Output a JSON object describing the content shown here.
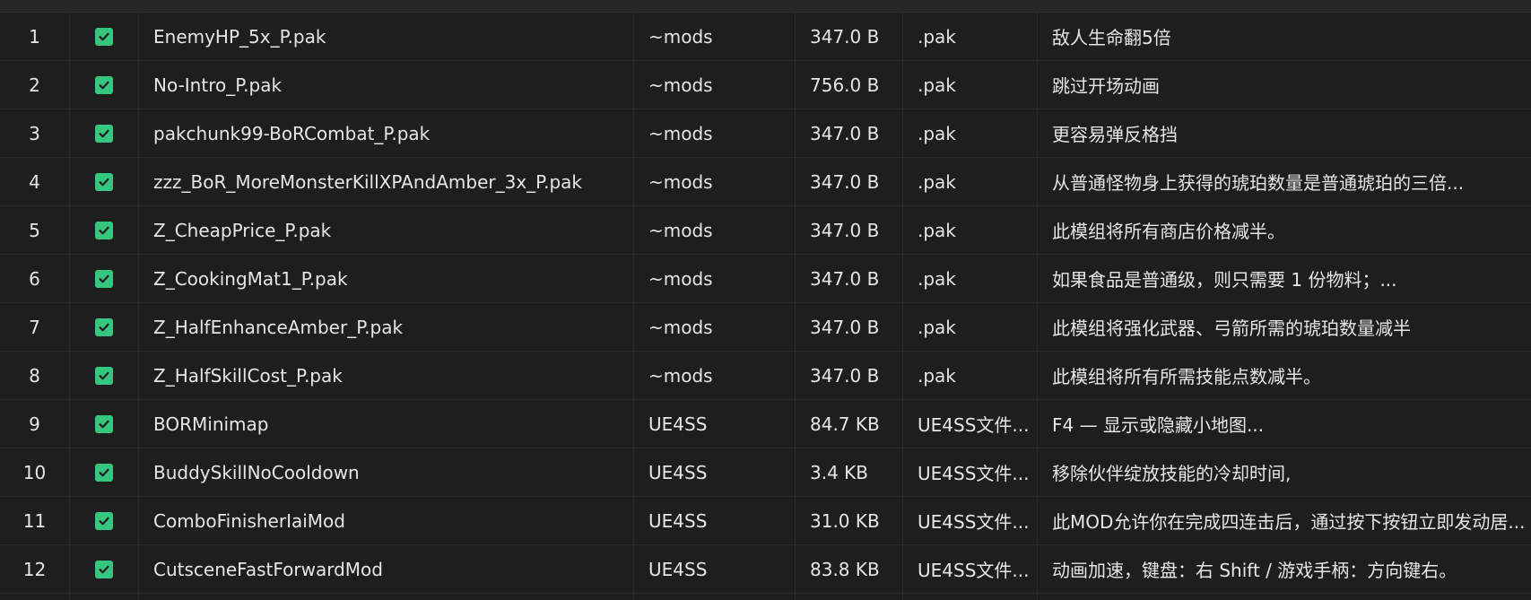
{
  "colors": {
    "background": "#1e1e1e",
    "row_border": "#2b2b2b",
    "checkbox_green": "#35c77f",
    "text": "#e6e6e6"
  },
  "rows": [
    {
      "index": "1",
      "checked": true,
      "name": "EnemyHP_5x_P.pak",
      "dir": "~mods",
      "size": "347.0 B",
      "type": ".pak",
      "desc": "敌人生命翻5倍"
    },
    {
      "index": "2",
      "checked": true,
      "name": "No-Intro_P.pak",
      "dir": "~mods",
      "size": "756.0 B",
      "type": ".pak",
      "desc": "跳过开场动画"
    },
    {
      "index": "3",
      "checked": true,
      "name": "pakchunk99-BoRCombat_P.pak",
      "dir": "~mods",
      "size": "347.0 B",
      "type": ".pak",
      "desc": "更容易弹反格挡"
    },
    {
      "index": "4",
      "checked": true,
      "name": "zzz_BoR_MoreMonsterKillXPAndAmber_3x_P.pak",
      "dir": "~mods",
      "size": "347.0 B",
      "type": ".pak",
      "desc": "从普通怪物身上获得的琥珀数量是普通琥珀的三倍..."
    },
    {
      "index": "5",
      "checked": true,
      "name": "Z_CheapPrice_P.pak",
      "dir": "~mods",
      "size": "347.0 B",
      "type": ".pak",
      "desc": "此模组将所有商店价格减半。"
    },
    {
      "index": "6",
      "checked": true,
      "name": "Z_CookingMat1_P.pak",
      "dir": "~mods",
      "size": "347.0 B",
      "type": ".pak",
      "desc": "如果食品是普通级，则只需要 1 份物料；..."
    },
    {
      "index": "7",
      "checked": true,
      "name": "Z_HalfEnhanceAmber_P.pak",
      "dir": "~mods",
      "size": "347.0 B",
      "type": ".pak",
      "desc": "此模组将强化武器、弓箭所需的琥珀数量减半"
    },
    {
      "index": "8",
      "checked": true,
      "name": "Z_HalfSkillCost_P.pak",
      "dir": "~mods",
      "size": "347.0 B",
      "type": ".pak",
      "desc": "此模组将所有所需技能点数减半。"
    },
    {
      "index": "9",
      "checked": true,
      "name": "BORMinimap",
      "dir": "UE4SS",
      "size": "84.7 KB",
      "type": "UE4SS文件...",
      "desc": "F4 — 显示或隐藏小地图..."
    },
    {
      "index": "10",
      "checked": true,
      "name": "BuddySkillNoCooldown",
      "dir": "UE4SS",
      "size": "3.4 KB",
      "type": "UE4SS文件...",
      "desc": "移除伙伴绽放技能的冷却时间,"
    },
    {
      "index": "11",
      "checked": true,
      "name": "ComboFinisherIaiMod",
      "dir": "UE4SS",
      "size": "31.0 KB",
      "type": "UE4SS文件...",
      "desc": "此MOD允许你在完成四连击后，通过按下按钮立即发动居..."
    },
    {
      "index": "12",
      "checked": true,
      "name": "CutsceneFastForwardMod",
      "dir": "UE4SS",
      "size": "83.8 KB",
      "type": "UE4SS文件...",
      "desc": "动画加速，键盘：右 Shift / 游戏手柄：方向键右。"
    }
  ]
}
